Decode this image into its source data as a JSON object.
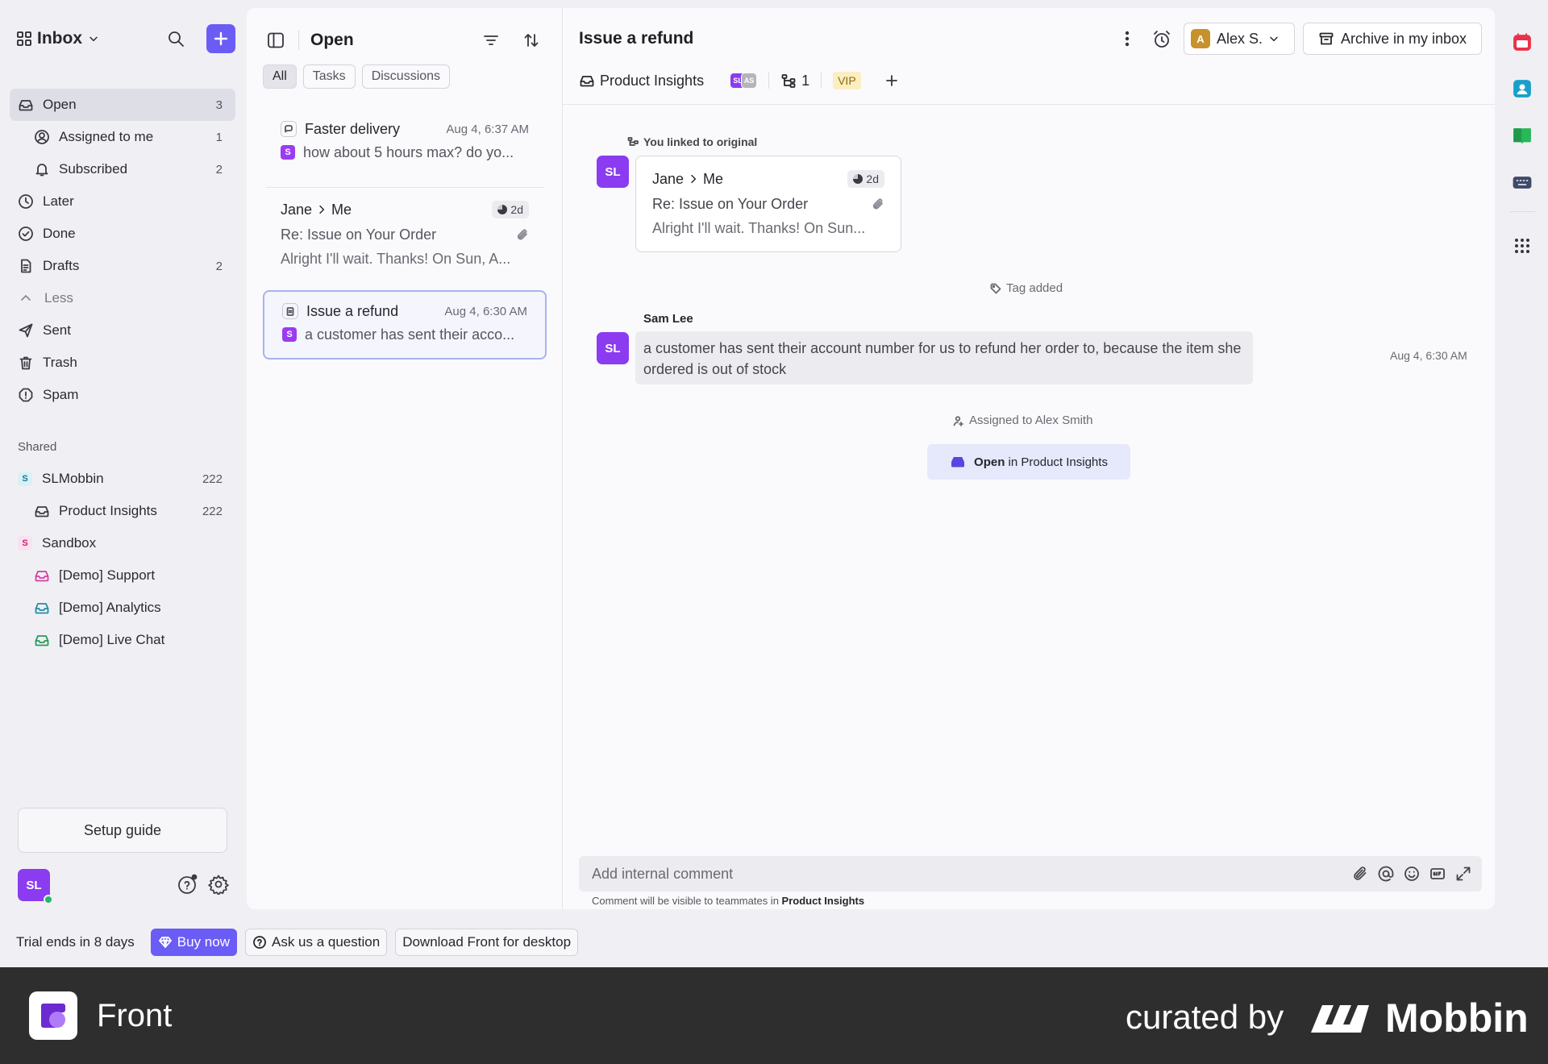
{
  "sidebar": {
    "inbox_label": "Inbox",
    "nav": [
      {
        "label": "Open",
        "count": "3"
      },
      {
        "label": "Assigned to me",
        "count": "1"
      },
      {
        "label": "Subscribed",
        "count": "2"
      },
      {
        "label": "Later",
        "count": ""
      },
      {
        "label": "Done",
        "count": ""
      },
      {
        "label": "Drafts",
        "count": "2"
      },
      {
        "label": "Less",
        "count": ""
      },
      {
        "label": "Sent",
        "count": ""
      },
      {
        "label": "Trash",
        "count": ""
      },
      {
        "label": "Spam",
        "count": ""
      }
    ],
    "shared_title": "Shared",
    "shared": [
      {
        "label": "SLMobbin",
        "count": "222",
        "badge": "S"
      },
      {
        "label": "Product Insights",
        "count": "222"
      },
      {
        "label": "Sandbox",
        "count": "",
        "badge": "S"
      },
      {
        "label": "[Demo] Support",
        "count": ""
      },
      {
        "label": "[Demo] Analytics",
        "count": ""
      },
      {
        "label": "[Demo] Live Chat",
        "count": ""
      }
    ],
    "setup_guide": "Setup guide",
    "user_initials": "SL"
  },
  "list": {
    "title": "Open",
    "chips": [
      "All",
      "Tasks",
      "Discussions"
    ],
    "conversations": [
      {
        "subject": "Faster delivery",
        "time": "Aug 4, 6:37 AM",
        "badge": "S",
        "preview": "how about 5 hours max? do yo..."
      },
      {
        "from": "Jane",
        "to": "Me",
        "age": "2d",
        "subject": "Re: Issue on Your Order",
        "preview": "Alright I'll wait. Thanks! On Sun, A..."
      },
      {
        "subject": "Issue a refund",
        "time": "Aug 4, 6:30 AM",
        "badge": "S",
        "preview": "a customer has sent their acco..."
      }
    ]
  },
  "main": {
    "title": "Issue a refund",
    "assignee_initial": "A",
    "assignee_name": "Alex S.",
    "archive_label": "Archive in my inbox",
    "inbox_tag": "Product Insights",
    "mini_avatars": [
      "SL",
      "AS"
    ],
    "linked_count": "1",
    "vip": "VIP",
    "linked_event": "You linked to original",
    "linked_card": {
      "from": "Jane",
      "to": "Me",
      "age": "2d",
      "subject": "Re: Issue on Your Order",
      "preview": "Alright I'll wait. Thanks! On Sun..."
    },
    "tag_event": "Tag added",
    "author": "Sam Lee",
    "author_initials": "SL",
    "comment": "a customer has sent their account number for us to refund her order to, because the item she ordered is out of stock",
    "comment_time": "Aug 4, 6:30 AM",
    "assigned_event": "Assigned to Alex Smith",
    "open_pill_bold": "Open",
    "open_pill_rest": "in Product Insights",
    "composer_placeholder": "Add internal comment",
    "composer_note_prefix": "Comment will be visible to teammates in",
    "composer_note_inbox": "Product Insights"
  },
  "trial": {
    "text": "Trial ends in 8 days",
    "buy": "Buy now",
    "ask": "Ask us a question",
    "download": "Download Front for desktop"
  },
  "footer": {
    "app_name": "Front",
    "curated": "curated by",
    "brand": "Mobbin"
  },
  "colors": {
    "accent": "#6b5cf6",
    "avatar_purple": "#8b3cf0",
    "assignee": "#c7912c",
    "vip_bg": "#fbeec0",
    "footer_bg": "#2e2e2e"
  }
}
